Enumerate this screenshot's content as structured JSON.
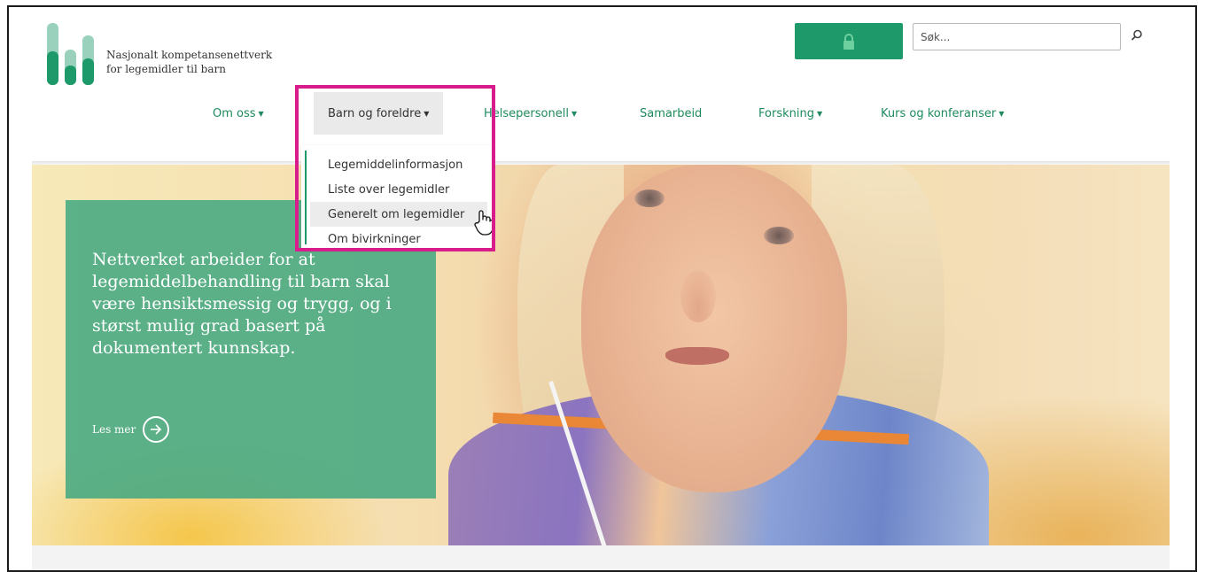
{
  "brand": {
    "name_line1": "Nasjonalt kompetansenettverk",
    "name_line2": "for legemidler til barn",
    "logo_color": "#1e9a6a"
  },
  "header": {
    "login_icon": "lock-icon",
    "search_placeholder": "Søk...",
    "search_icon": "search-icon"
  },
  "nav": {
    "items": [
      {
        "label": "Om oss",
        "has_caret": true
      },
      {
        "label": "Barn og foreldre",
        "has_caret": true,
        "active": true
      },
      {
        "label": "Helsepersonell",
        "has_caret": true
      },
      {
        "label": "Samarbeid",
        "has_caret": false
      },
      {
        "label": "Forskning",
        "has_caret": true
      },
      {
        "label": "Kurs og konferanser",
        "has_caret": true
      }
    ],
    "dropdown": {
      "items": [
        {
          "label": "Legemiddelinformasjon"
        },
        {
          "label": "Liste over legemidler"
        },
        {
          "label": "Generelt om legemidler",
          "hovered": true
        },
        {
          "label": "Om bivirkninger"
        }
      ]
    }
  },
  "hero": {
    "text": "Nettverket arbeider for at legemiddelbehandling til barn skal være hensiktsmessig og trygg, og i størst mulig grad basert på dokumentert kunnskap.",
    "cta_label": "Les mer",
    "cta_icon": "arrow-right-circle-icon"
  },
  "colors": {
    "accent": "#1e9a6a",
    "nav_text": "#1e8a5e",
    "highlight_border": "#d81c8c"
  }
}
